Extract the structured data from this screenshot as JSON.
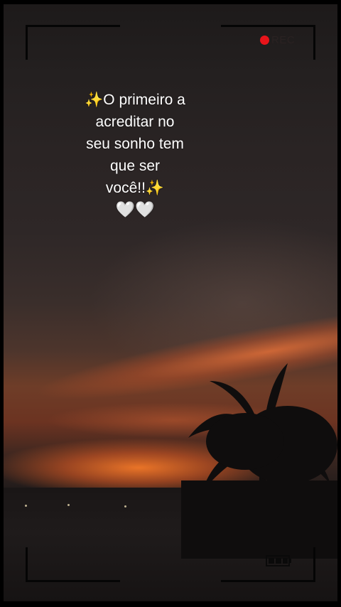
{
  "overlay": {
    "rec_label": "REC",
    "rec_color": "#e8141a"
  },
  "caption": {
    "lines": [
      "✨O primeiro a",
      "acreditar no",
      "seu sonho tem",
      "que ser",
      "você!!✨"
    ],
    "hearts": "🤍🤍"
  },
  "icons": {
    "recording": "record-dot-icon",
    "battery": "battery-icon"
  }
}
